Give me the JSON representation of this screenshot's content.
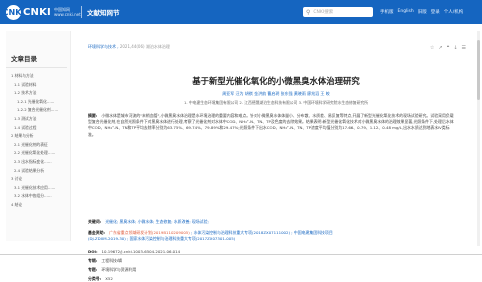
{
  "header": {
    "logo_mark": "CNKI",
    "brand": "CNKI",
    "brand_sub": "中国知网 www.cnki.net",
    "site_name": "文献知网节",
    "search_placeholder": "CNKI搜索",
    "links": [
      "手机版",
      "English",
      "旧版",
      "登录",
      "个人/机构"
    ]
  },
  "sidebar": {
    "heading": "文章目录",
    "items": [
      {
        "level": 1,
        "label": "1 材料与方法"
      },
      {
        "level": 2,
        "label": "1.1 试验材料"
      },
      {
        "level": 2,
        "label": "1.2 技术方法"
      },
      {
        "level": 3,
        "label": "1.2.1 光催化氧化……"
      },
      {
        "level": 3,
        "label": "1.2.2 复合光催化剂……"
      },
      {
        "level": 2,
        "label": "1.3 测试方法"
      },
      {
        "level": 2,
        "label": "1.4 试验过程"
      },
      {
        "level": 1,
        "label": "2 结果与分析"
      },
      {
        "level": 2,
        "label": "2.1 光催化剂的表征"
      },
      {
        "level": 2,
        "label": "2.2 光催化氧化处理……"
      },
      {
        "level": 2,
        "label": "2.3 出水指标变化……"
      },
      {
        "level": 2,
        "label": "2.4 试验结果分析"
      },
      {
        "level": 1,
        "label": "3 讨论"
      },
      {
        "level": 2,
        "label": "3.1 光催化技术应用……"
      },
      {
        "level": 2,
        "label": "3.2 水体中各组分……"
      },
      {
        "level": 1,
        "label": "4 结论"
      }
    ]
  },
  "article": {
    "breadcrumb_prefix": "环境科学与技术 ,",
    "breadcrumb_issue": "2021,44(06)",
    "breadcrumb_suffix": "湖泊水体治理",
    "actions": [
      "收藏",
      "分享",
      "引用",
      "下载",
      "阅读"
    ],
    "title": "基于新型光催化氧化的小微黑臭水体治理研究",
    "authors": "周亚军  汪为  胡祺  金洪韵  曹启玥  张东强  黄晓雨  廖兆滔  王 皎",
    "affiliation": "1. 中电建生态环境集团有限公司  2. 江西德晟湖泊生态科技有限公司  3. 中国环境科学研究院水生态修复研究所",
    "abstract_label": "摘要:",
    "abstract": "小微水体是城市河流的\"末梢血管\",小微黑臭水体治理是水环境治理的重要内容和难点。针对小微黑臭水体体量小、分布散、水质差、易反复等特点,开展了新型光催化氧化技术的现场试验研究。试验采用负载型复合光催化剂,在自然光照条件下对黑臭水体进行处理,考察了光催化剂对水体中COD、NH₄⁺-N、TN、TP及色度的去除效果。结果表明:新型光催化氧化技术对小微黑臭水体的治理效果显著,光照条件下,处理后水体中COD、NH₄⁺-N、TN和TP平均去除率分别为63.75%、69.74%、79.89%和29.47%;光照条件下出水COD、NH₄⁺-N、TN、TP浓度平均值分别为17.66、0.79、1.12、0.48 mg/L,出水水质达到地表水Ⅳ类标准。",
    "keywords_label": "关键词:",
    "keywords": "光催化; 黑臭水体; 小微水体; 生态修复; 水质改善; 现场试验;",
    "fund_label": "基金资助:",
    "fund_highlight": "广东省重点领域研发计划(2019B110209005)",
    "fund_rest": " ; 水体污染控制与治理科技重大专项(2018ZX07111002) ; 中国电建集团科技项目",
    "fund_line2": "(DJ-ZDXM-2019-30) ; 国家水体污染控制与治理科技重大专项(2017ZX07301-005)",
    "doi_label": "DOI:",
    "doi": "10.19672/j.cnki.1003-6504.2021.06.014",
    "column_label": "专辑:",
    "column": "工程科技Ⅰ辑",
    "special_label": "专题:",
    "special": "环境科学与资源利用",
    "class_label": "分类号:",
    "class_no": "X52"
  }
}
